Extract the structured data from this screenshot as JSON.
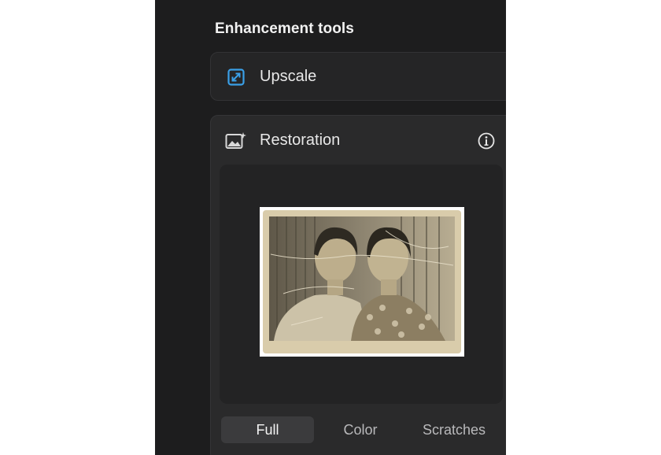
{
  "section": {
    "title": "Enhancement tools"
  },
  "tools": [
    {
      "label": "Upscale",
      "icon": "upscale-icon",
      "accent": "#3aa0e8"
    },
    {
      "label": "Restoration",
      "icon": "image-sparkle-icon",
      "info_icon": "info-icon"
    }
  ],
  "restoration": {
    "preview_image": "old-sepia-photo-two-women",
    "modes": [
      "Full",
      "Color",
      "Scratches"
    ],
    "selected_mode": "Full"
  },
  "colors": {
    "panel_bg": "#1d1d1e",
    "card_bg": "#2a2a2b",
    "segment_active": "#3b3b3d"
  }
}
